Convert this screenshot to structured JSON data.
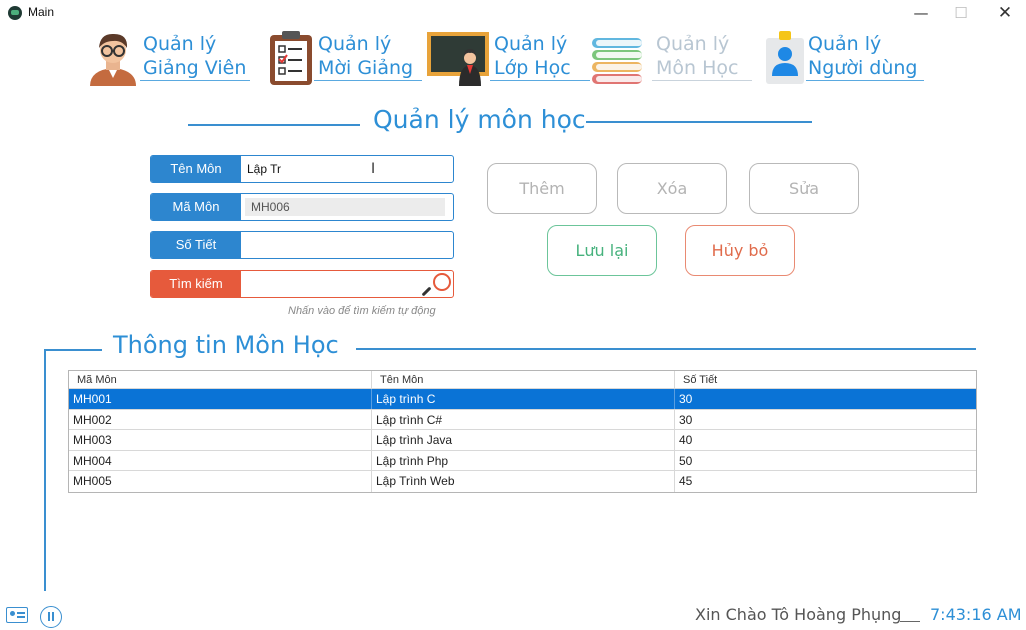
{
  "window": {
    "title": "Main",
    "minimize": "—",
    "maximize": "☐",
    "close": "✕"
  },
  "nav": [
    {
      "line1": "Quản lý",
      "line2": "Giảng Viên",
      "icon": "teacher-icon",
      "enabled": true
    },
    {
      "line1": "Quản lý",
      "line2": "Mời Giảng",
      "icon": "clipboard-icon",
      "enabled": true
    },
    {
      "line1": "Quản lý",
      "line2": "Lớp Học",
      "icon": "classroom-icon",
      "enabled": true
    },
    {
      "line1": "Quản lý",
      "line2": "Môn Học",
      "icon": "books-icon",
      "enabled": false
    },
    {
      "line1": "Quản lý",
      "line2": "Người dùng",
      "icon": "user-icon",
      "enabled": true
    }
  ],
  "section_title": "Quản lý môn học",
  "form": {
    "ten_mon": {
      "label": "Tên Môn",
      "value": "Lập Tr"
    },
    "ma_mon": {
      "label": "Mã Môn",
      "value": "MH006"
    },
    "so_tiet": {
      "label": "Số Tiết",
      "value": ""
    },
    "tim_kiem": {
      "label": "Tìm kiếm",
      "value": ""
    },
    "hint": "Nhấn vào để tìm kiếm tự động"
  },
  "buttons": {
    "them": "Thêm",
    "xoa": "Xóa",
    "sua": "Sửa",
    "luu": "Lưu lại",
    "huy": "Hủy bỏ"
  },
  "group_title": "Thông tin Môn Học",
  "table": {
    "columns": [
      "Mã Môn",
      "Tên Môn",
      "Số Tiết"
    ],
    "rows": [
      [
        "MH001",
        "Lập trình C",
        "30"
      ],
      [
        "MH002",
        "Lập trình C#",
        "30"
      ],
      [
        "MH003",
        "Lập trình Java",
        "40"
      ],
      [
        "MH004",
        "Lập trình Php",
        "50"
      ],
      [
        "MH005",
        "Lập Trình Web",
        "45"
      ]
    ],
    "selected_row": 0
  },
  "status": {
    "greeting": "Xin Chào Tô Hoàng Phụng",
    "time": "7:43:16 AM"
  },
  "colors": {
    "accent": "#2d86cf",
    "search": "#e65a3c",
    "selected_row": "#0a73d6",
    "save": "#46b27d",
    "cancel": "#e06b4b"
  }
}
